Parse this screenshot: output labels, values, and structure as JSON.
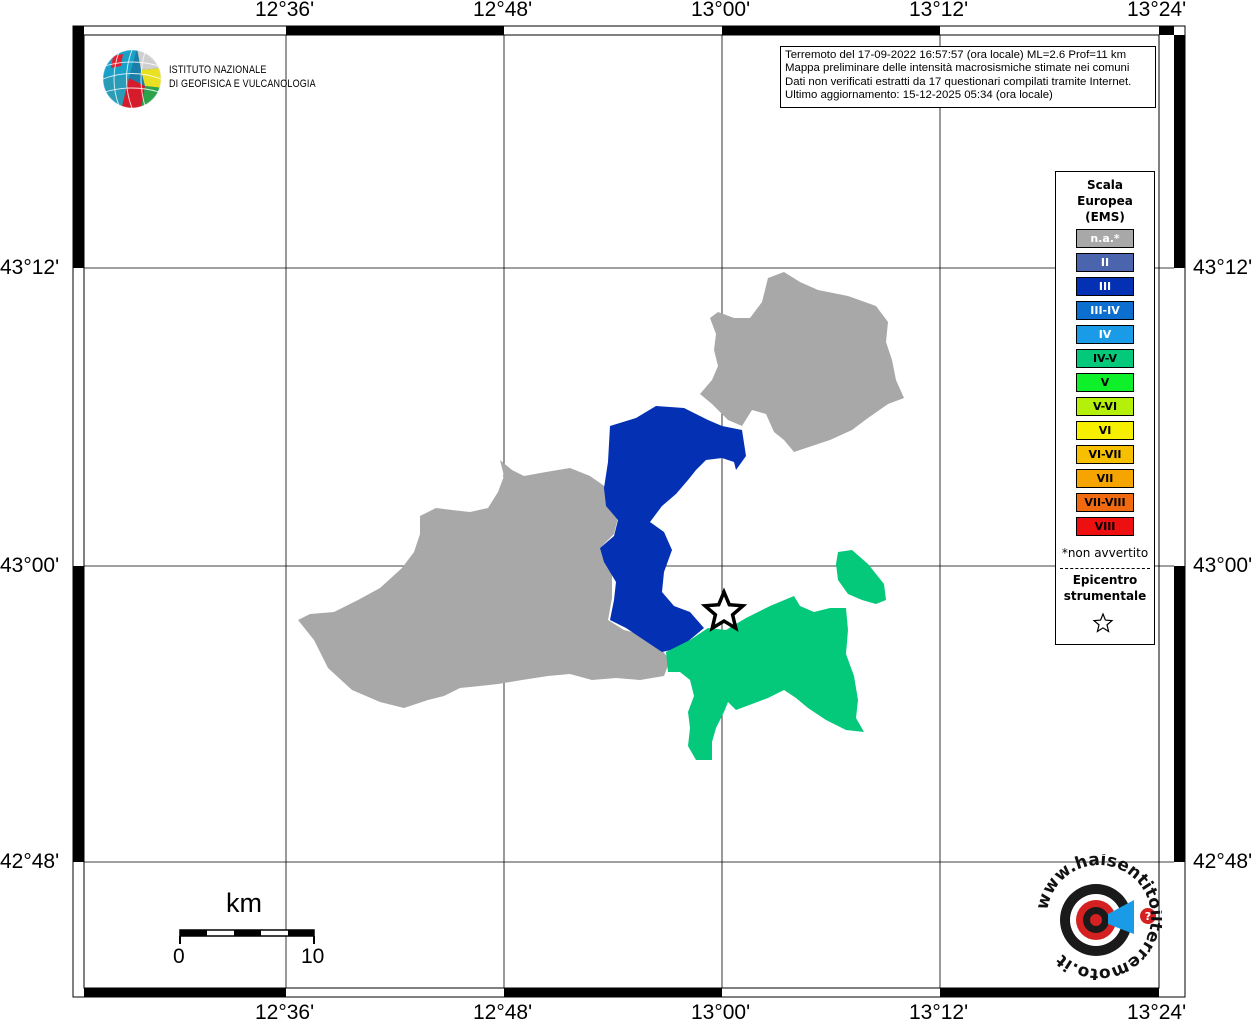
{
  "axes": {
    "top_lon_labels": [
      "12°36'",
      "12°48'",
      "13°00'",
      "13°12'",
      "13°24'"
    ],
    "bottom_lon_labels": [
      "12°36'",
      "12°48'",
      "13°00'",
      "13°12'",
      "13°24'"
    ],
    "left_lat_labels": [
      "43°12'",
      "43°00'",
      "42°48'"
    ],
    "right_lat_labels": [
      "43°12'",
      "43°00'",
      "42°48'"
    ]
  },
  "logo": {
    "line1": "ISTITUTO NAZIONALE",
    "line2": "DI GEOFISICA E VULCANOLOGIA"
  },
  "info": {
    "line1": "Terremoto del 17-09-2022 16:57:57 (ora locale) ML=2.6 Prof=11 km",
    "line2": "Mappa preliminare delle intensità macrosismiche stimate nei comuni",
    "line3": "Dati non verificati estratti da 17 questionari compilati tramite Internet.",
    "line4": "Ultimo aggiornamento: 15-12-2025 05:34 (ora locale)"
  },
  "legend": {
    "title_line1": "Scala",
    "title_line2": "Europea",
    "title_line3": "(EMS)",
    "items": [
      {
        "label": "n.a.*",
        "color": "#a8a8a8",
        "text_color": "#ffffff"
      },
      {
        "label": "II",
        "color": "#4a65ad",
        "text_color": "#ffffff"
      },
      {
        "label": "III",
        "color": "#0430b3",
        "text_color": "#ffffff"
      },
      {
        "label": "III-IV",
        "color": "#0c6fd0",
        "text_color": "#ffffff"
      },
      {
        "label": "IV",
        "color": "#1a9be8",
        "text_color": "#ffffff"
      },
      {
        "label": "IV-V",
        "color": "#04c87a",
        "text_color": "#000000"
      },
      {
        "label": "V",
        "color": "#0ef02a",
        "text_color": "#000000"
      },
      {
        "label": "V-VI",
        "color": "#b4f00a",
        "text_color": "#000000"
      },
      {
        "label": "VI",
        "color": "#f6f000",
        "text_color": "#000000"
      },
      {
        "label": "VI-VII",
        "color": "#f6c000",
        "text_color": "#000000"
      },
      {
        "label": "VII",
        "color": "#f6a400",
        "text_color": "#000000"
      },
      {
        "label": "VII-VIII",
        "color": "#f26a10",
        "text_color": "#000000"
      },
      {
        "label": "VIII",
        "color": "#ee1010",
        "text_color": "#000000"
      }
    ],
    "note": "*non avvertito",
    "epicenter_line1": "Epicentro",
    "epicenter_line2": "strumentale"
  },
  "scalebar": {
    "unit": "km",
    "start": "0",
    "end": "10"
  },
  "badge": {
    "text": "www.haisentitoilterremoto.it",
    "icon": "concentric-target-icon"
  },
  "map_colors": {
    "na": "#a8a8a8",
    "iii": "#0430b3",
    "iv_v": "#04c87a"
  }
}
